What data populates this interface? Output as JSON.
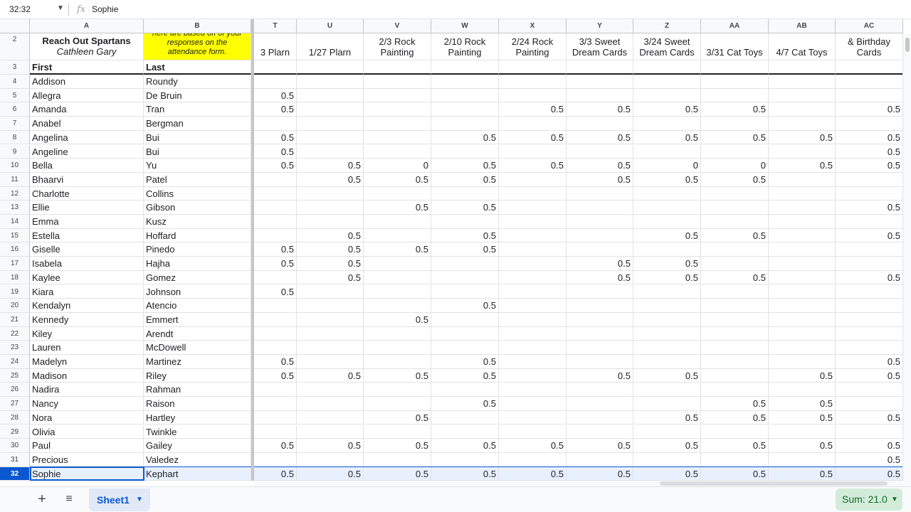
{
  "formula_bar": {
    "name_box": "32:32",
    "fx_icon": "fx",
    "value": "Sophie"
  },
  "columns": [
    {
      "letter": "A"
    },
    {
      "letter": "B"
    },
    {
      "letter": "T"
    },
    {
      "letter": "U"
    },
    {
      "letter": "V"
    },
    {
      "letter": "W"
    },
    {
      "letter": "X"
    },
    {
      "letter": "Y"
    },
    {
      "letter": "Z"
    },
    {
      "letter": "AA"
    },
    {
      "letter": "AB"
    },
    {
      "letter": "AC"
    }
  ],
  "row2": {
    "a_line1": "Reach Out Spartans",
    "a_line2": "Cathleen Gary",
    "b_text": "here are based off of your responses on the attendance form.",
    "event_headers": [
      "3 Plarn",
      "1/27 Plarn",
      "2/3 Rock Painting",
      "2/10 Rock Painting",
      "2/24 Rock Painting",
      "3/3 Sweet Dream Cards",
      "3/24 Sweet Dream Cards",
      "3/31 Cat Toys",
      "4/7 Cat Toys",
      "& Birthday Cards"
    ]
  },
  "row3": {
    "first": "First",
    "last": "Last"
  },
  "rows": [
    {
      "n": "4",
      "first": "Addison",
      "last": "Roundy",
      "v": [
        "",
        "",
        "",
        "",
        "",
        "",
        "",
        "",
        "",
        ""
      ]
    },
    {
      "n": "5",
      "first": "Allegra",
      "last": "De Bruin",
      "v": [
        "0.5",
        "",
        "",
        "",
        "",
        "",
        "",
        "",
        "",
        ""
      ]
    },
    {
      "n": "6",
      "first": "Amanda",
      "last": "Tran",
      "v": [
        "0.5",
        "",
        "",
        "",
        "0.5",
        "0.5",
        "0.5",
        "0.5",
        "",
        "0.5"
      ]
    },
    {
      "n": "7",
      "first": "Anabel",
      "last": "Bergman",
      "v": [
        "",
        "",
        "",
        "",
        "",
        "",
        "",
        "",
        "",
        ""
      ]
    },
    {
      "n": "8",
      "first": "Angelina",
      "last": "Bui",
      "v": [
        "0.5",
        "",
        "",
        "0.5",
        "0.5",
        "0.5",
        "0.5",
        "0.5",
        "0.5",
        "0.5"
      ]
    },
    {
      "n": "9",
      "first": "Angeline",
      "last": "Bui",
      "v": [
        "0.5",
        "",
        "",
        "",
        "",
        "",
        "",
        "",
        "",
        "0.5"
      ]
    },
    {
      "n": "10",
      "first": "Bella",
      "last": "Yu",
      "v": [
        "0.5",
        "0.5",
        "0",
        "0.5",
        "0.5",
        "0.5",
        "0",
        "0",
        "0.5",
        "0.5"
      ]
    },
    {
      "n": "11",
      "first": "Bhaarvi",
      "last": "Patel",
      "v": [
        "",
        "0.5",
        "0.5",
        "0.5",
        "",
        "0.5",
        "0.5",
        "0.5",
        "",
        ""
      ]
    },
    {
      "n": "12",
      "first": "Charlotte",
      "last": "Collins",
      "v": [
        "",
        "",
        "",
        "",
        "",
        "",
        "",
        "",
        "",
        ""
      ]
    },
    {
      "n": "13",
      "first": "Ellie",
      "last": "Gibson",
      "v": [
        "",
        "",
        "0.5",
        "0.5",
        "",
        "",
        "",
        "",
        "",
        "0.5"
      ]
    },
    {
      "n": "14",
      "first": "Emma",
      "last": "Kusz",
      "v": [
        "",
        "",
        "",
        "",
        "",
        "",
        "",
        "",
        "",
        ""
      ]
    },
    {
      "n": "15",
      "first": "Estella",
      "last": "Hoffard",
      "v": [
        "",
        "0.5",
        "",
        "0.5",
        "",
        "",
        "0.5",
        "0.5",
        "",
        "0.5"
      ]
    },
    {
      "n": "16",
      "first": "Giselle",
      "last": "Pinedo",
      "v": [
        "0.5",
        "0.5",
        "0.5",
        "0.5",
        "",
        "",
        "",
        "",
        "",
        ""
      ]
    },
    {
      "n": "17",
      "first": "Isabela",
      "last": "Hajha",
      "v": [
        "0.5",
        "0.5",
        "",
        "",
        "",
        "0.5",
        "0.5",
        "",
        "",
        ""
      ]
    },
    {
      "n": "18",
      "first": "Kaylee",
      "last": "Gomez",
      "v": [
        "",
        "0.5",
        "",
        "",
        "",
        "0.5",
        "0.5",
        "0.5",
        "",
        "0.5"
      ]
    },
    {
      "n": "19",
      "first": "Kiara",
      "last": "Johnson",
      "v": [
        "0.5",
        "",
        "",
        "",
        "",
        "",
        "",
        "",
        "",
        ""
      ]
    },
    {
      "n": "20",
      "first": "Kendalyn",
      "last": "Atencio",
      "v": [
        "",
        "",
        "",
        "0.5",
        "",
        "",
        "",
        "",
        "",
        ""
      ]
    },
    {
      "n": "21",
      "first": "Kennedy",
      "last": "Emmert",
      "v": [
        "",
        "",
        "0.5",
        "",
        "",
        "",
        "",
        "",
        "",
        ""
      ]
    },
    {
      "n": "22",
      "first": "Kiley",
      "last": "Arendt",
      "v": [
        "",
        "",
        "",
        "",
        "",
        "",
        "",
        "",
        "",
        ""
      ]
    },
    {
      "n": "23",
      "first": "Lauren",
      "last": "McDowell",
      "v": [
        "",
        "",
        "",
        "",
        "",
        "",
        "",
        "",
        "",
        ""
      ]
    },
    {
      "n": "24",
      "first": "Madelyn",
      "last": "Martinez",
      "v": [
        "0.5",
        "",
        "",
        "0.5",
        "",
        "",
        "",
        "",
        "",
        "0.5"
      ]
    },
    {
      "n": "25",
      "first": "Madison",
      "last": "Riley",
      "v": [
        "0.5",
        "0.5",
        "0.5",
        "0.5",
        "",
        "0.5",
        "0.5",
        "",
        "0.5",
        "0.5"
      ]
    },
    {
      "n": "26",
      "first": "Nadira",
      "last": "Rahman",
      "v": [
        "",
        "",
        "",
        "",
        "",
        "",
        "",
        "",
        "",
        ""
      ]
    },
    {
      "n": "27",
      "first": "Nancy",
      "last": "Raison",
      "v": [
        "",
        "",
        "",
        "0.5",
        "",
        "",
        "",
        "0.5",
        "0.5",
        ""
      ]
    },
    {
      "n": "28",
      "first": "Nora",
      "last": "Hartley",
      "v": [
        "",
        "",
        "0.5",
        "",
        "",
        "",
        "0.5",
        "0.5",
        "0.5",
        "0.5"
      ]
    },
    {
      "n": "29",
      "first": "Olivia",
      "last": "Twinkle",
      "v": [
        "",
        "",
        "",
        "",
        "",
        "",
        "",
        "",
        "",
        ""
      ]
    },
    {
      "n": "30",
      "first": "Paul",
      "last": "Gailey",
      "v": [
        "0.5",
        "0.5",
        "0.5",
        "0.5",
        "0.5",
        "0.5",
        "0.5",
        "0.5",
        "0.5",
        "0.5"
      ]
    },
    {
      "n": "31",
      "first": "Precious",
      "last": "Valedez",
      "v": [
        "",
        "",
        "",
        "",
        "",
        "",
        "",
        "",
        "",
        "0.5"
      ]
    },
    {
      "n": "32",
      "first": "Sophie",
      "last": "Kephart",
      "v": [
        "0.5",
        "0.5",
        "0.5",
        "0.5",
        "0.5",
        "0.5",
        "0.5",
        "0.5",
        "0.5",
        "0.5"
      ],
      "selected": true
    }
  ],
  "bottom_bar": {
    "add_sheet": "+",
    "all_sheets": "≡",
    "sheet_name": "Sheet1",
    "sum_label": "Sum: 21.0"
  },
  "colors": {
    "header_yellow": "#ffff00",
    "accent": "#0b57d0",
    "selected_row": "#e8f0fe",
    "sum_bg": "#d3ecd9"
  }
}
